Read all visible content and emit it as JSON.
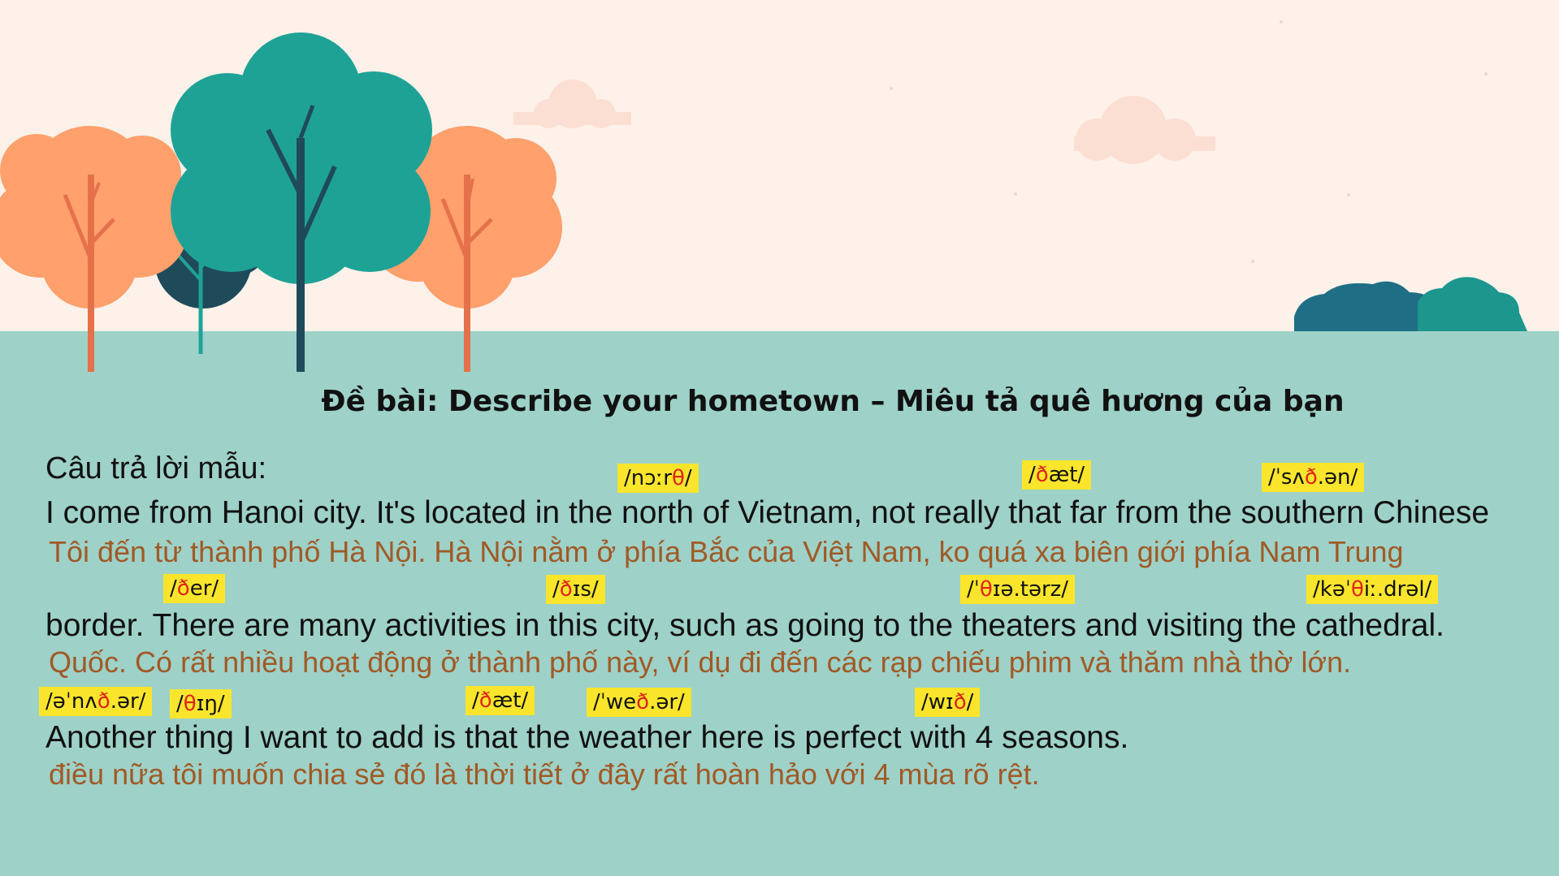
{
  "colors": {
    "sky": "#fdf1ea",
    "ground": "#9ed1c8",
    "orange_tree": "#ffa06d",
    "teal_tree": "#1fa296",
    "dark_tree": "#1f4a5a",
    "highlight": "#fbe52c",
    "translation_text": "#a05a26",
    "ipa_accent": "#e2231a"
  },
  "title": "Đề bài: Describe your hometown – Miêu tả quê hương của bạn",
  "answer_label": "Câu trả lời mẫu:",
  "lines": [
    {
      "english": "I come from Hanoi city. It's located in the north of Vietnam, not really that far from the southern Chinese",
      "vietnamese": "Tôi đến từ thành phố Hà Nội. Hà Nội nằm ở phía Bắc của Việt Nam, ko quá xa biên giới phía Nam Trung",
      "ipa": [
        {
          "pre": "/nɔːr",
          "accent": "θ",
          "post": "/"
        },
        {
          "pre": "/",
          "accent": "ð",
          "post": "æt/"
        },
        {
          "pre": "/ˈsʌ",
          "accent": "ð",
          "post": ".ən/"
        }
      ]
    },
    {
      "english": "border. There are many activities in this city, such as going to the theaters and visiting the cathedral.",
      "vietnamese": "Quốc. Có rất nhiều hoạt động ở thành phố này, ví dụ đi đến các rạp chiếu phim và thăm nhà thờ lớn.",
      "ipa": [
        {
          "pre": "/",
          "accent": "ð",
          "post": "er/"
        },
        {
          "pre": "/",
          "accent": "ð",
          "post": "ɪs/"
        },
        {
          "pre": "/ˈ",
          "accent": "θ",
          "post": "ɪə.tərz/"
        },
        {
          "pre": "/kəˈ",
          "accent": "θ",
          "post": "iː.drəl/"
        }
      ]
    },
    {
      "english": "Another thing I want to add is that the weather here is perfect with 4 seasons.",
      "vietnamese": "điều nữa tôi muốn chia sẻ đó là thời tiết ở đây rất hoàn hảo với 4 mùa rõ rệt.",
      "ipa": [
        {
          "pre": "/əˈnʌ",
          "accent": "ð",
          "post": ".ər/"
        },
        {
          "pre": "/",
          "accent": "θ",
          "post": "ɪŋ/"
        },
        {
          "pre": "/",
          "accent": "ð",
          "post": "æt/"
        },
        {
          "pre": "/ˈwe",
          "accent": "ð",
          "post": ".ər/"
        },
        {
          "pre": "/wɪ",
          "accent": "ð",
          "post": "/"
        }
      ]
    }
  ]
}
